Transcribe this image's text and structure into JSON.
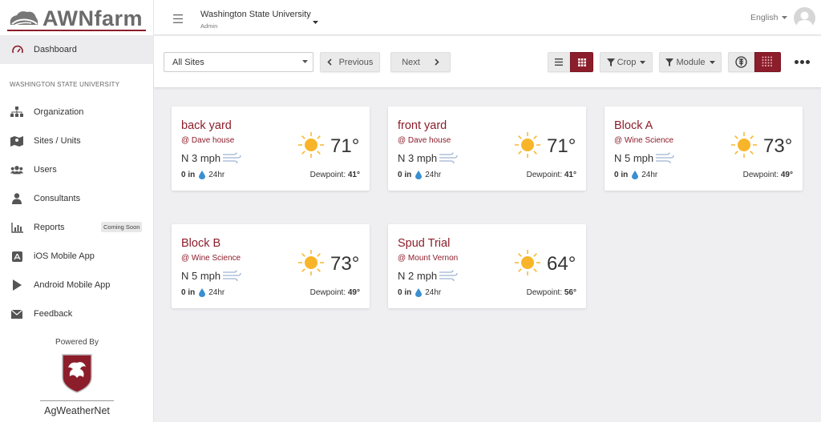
{
  "brand": {
    "logo_text": "AWNfarm",
    "footer_powered": "Powered By",
    "footer_name": "AgWeatherNet",
    "accent": "#8c1d2a"
  },
  "sidebar": {
    "dashboard_label": "Dashboard",
    "section_title": "WASHINGTON STATE UNIVERSITY",
    "items": [
      {
        "label": "Organization",
        "icon": "sitemap-icon"
      },
      {
        "label": "Sites / Units",
        "icon": "map-icon"
      },
      {
        "label": "Users",
        "icon": "users-icon"
      },
      {
        "label": "Consultants",
        "icon": "user-tie-icon"
      },
      {
        "label": "Reports",
        "icon": "bar-chart-icon",
        "badge": "Coming Soon"
      },
      {
        "label": "iOS Mobile App",
        "icon": "app-store-icon"
      },
      {
        "label": "Android Mobile App",
        "icon": "play-icon"
      },
      {
        "label": "Feedback",
        "icon": "envelope-icon"
      }
    ]
  },
  "header": {
    "org_name": "Washington State University",
    "org_role": "Admin",
    "language": "English"
  },
  "toolbar": {
    "site_select": "All Sites",
    "previous": "Previous",
    "next": "Next",
    "crop": "Crop",
    "module": "Module"
  },
  "cards": [
    {
      "title": "back yard",
      "location": "@ Dave house",
      "wind": "N 3 mph",
      "rain": "0 in",
      "period": "24hr",
      "temp": "71°",
      "dewpoint_label": "Dewpoint:",
      "dewpoint": "41°"
    },
    {
      "title": "front yard",
      "location": "@ Dave house",
      "wind": "N 3 mph",
      "rain": "0 in",
      "period": "24hr",
      "temp": "71°",
      "dewpoint_label": "Dewpoint:",
      "dewpoint": "41°"
    },
    {
      "title": "Block A",
      "location": "@ Wine Science",
      "wind": "N 5 mph",
      "rain": "0 in",
      "period": "24hr",
      "temp": "73°",
      "dewpoint_label": "Dewpoint:",
      "dewpoint": "49°"
    },
    {
      "title": "Block B",
      "location": "@ Wine Science",
      "wind": "N 5 mph",
      "rain": "0 in",
      "period": "24hr",
      "temp": "73°",
      "dewpoint_label": "Dewpoint:",
      "dewpoint": "49°"
    },
    {
      "title": "Spud Trial",
      "location": "@ Mount Vernon",
      "wind": "N 2 mph",
      "rain": "0 in",
      "period": "24hr",
      "temp": "64°",
      "dewpoint_label": "Dewpoint:",
      "dewpoint": "56°"
    }
  ]
}
